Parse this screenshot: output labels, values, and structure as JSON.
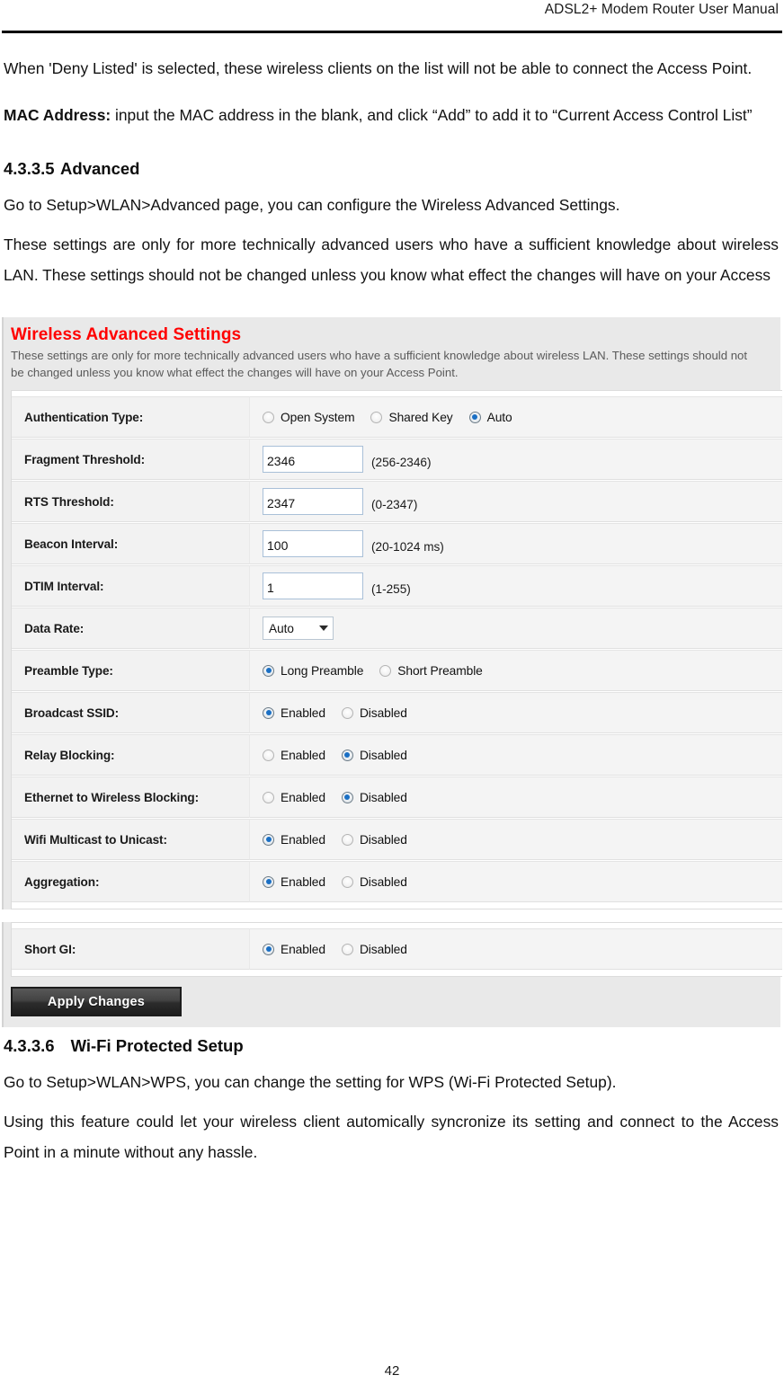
{
  "header": {
    "title": "ADSL2+ Modem Router User Manual"
  },
  "doc": {
    "para_deny": "When 'Deny Listed' is selected, these wireless clients on the list will not be able to connect the Access Point.",
    "mac_label": "MAC Address:",
    "mac_text": " input the MAC address in the blank, and click “Add” to add it to “Current Access Control List”",
    "heading_advanced_num": "4.3.3.5",
    "heading_advanced_text": "Advanced",
    "para_goto_advanced": "Go to Setup>WLAN>Advanced page, you can configure the Wireless Advanced Settings.",
    "para_advanced_note": "These settings are only for more technically advanced users who have a sufficient knowledge about wireless LAN. These settings should not be changed unless you know what effect the changes will have on your Access",
    "heading_wps_num": "4.3.3.6",
    "heading_wps_text": "Wi-Fi Protected Setup",
    "para_goto_wps": "Go to Setup>WLAN>WPS, you can change the setting for WPS (Wi-Fi Protected Setup).",
    "para_wps_note": "Using this feature could let your wireless client automically syncronize its setting and connect to the Access Point in a minute without any hassle.",
    "page_number": "42"
  },
  "screenshot": {
    "title": "Wireless Advanced Settings",
    "title_color": "#ff0000",
    "description": "These settings are only for more technically advanced users who have a sufficient knowledge about wireless LAN. These settings should not be changed unless you know what effect the changes will have on your Access Point.",
    "rows": [
      {
        "label": "Authentication Type:",
        "type": "radio",
        "options": [
          {
            "label": "Open System",
            "checked": false
          },
          {
            "label": "Shared Key",
            "checked": false
          },
          {
            "label": "Auto",
            "checked": true
          }
        ]
      },
      {
        "label": "Fragment Threshold:",
        "type": "text",
        "value": "2346",
        "hint": "(256-2346)"
      },
      {
        "label": "RTS Threshold:",
        "type": "text",
        "value": "2347",
        "hint": "(0-2347)"
      },
      {
        "label": "Beacon Interval:",
        "type": "text",
        "value": "100",
        "hint": "(20-1024 ms)"
      },
      {
        "label": "DTIM Interval:",
        "type": "text",
        "value": "1",
        "hint": "(1-255)"
      },
      {
        "label": "Data Rate:",
        "type": "select",
        "value": "Auto"
      },
      {
        "label": "Preamble Type:",
        "type": "radio",
        "options": [
          {
            "label": "Long Preamble",
            "checked": true
          },
          {
            "label": "Short Preamble",
            "checked": false
          }
        ]
      },
      {
        "label": "Broadcast SSID:",
        "type": "radio",
        "options": [
          {
            "label": "Enabled",
            "checked": true
          },
          {
            "label": "Disabled",
            "checked": false
          }
        ]
      },
      {
        "label": "Relay Blocking:",
        "type": "radio",
        "options": [
          {
            "label": "Enabled",
            "checked": false
          },
          {
            "label": "Disabled",
            "checked": true
          }
        ]
      },
      {
        "label": "Ethernet to Wireless Blocking:",
        "type": "radio",
        "options": [
          {
            "label": "Enabled",
            "checked": false
          },
          {
            "label": "Disabled",
            "checked": true
          }
        ]
      },
      {
        "label": "Wifi Multicast to Unicast:",
        "type": "radio",
        "options": [
          {
            "label": "Enabled",
            "checked": true
          },
          {
            "label": "Disabled",
            "checked": false
          }
        ]
      },
      {
        "label": "Aggregation:",
        "type": "radio",
        "options": [
          {
            "label": "Enabled",
            "checked": true
          },
          {
            "label": "Disabled",
            "checked": false
          }
        ]
      }
    ],
    "rows_second": [
      {
        "label": "Short GI:",
        "type": "radio",
        "options": [
          {
            "label": "Enabled",
            "checked": true
          },
          {
            "label": "Disabled",
            "checked": false
          }
        ]
      }
    ],
    "apply_button": "Apply Changes"
  }
}
